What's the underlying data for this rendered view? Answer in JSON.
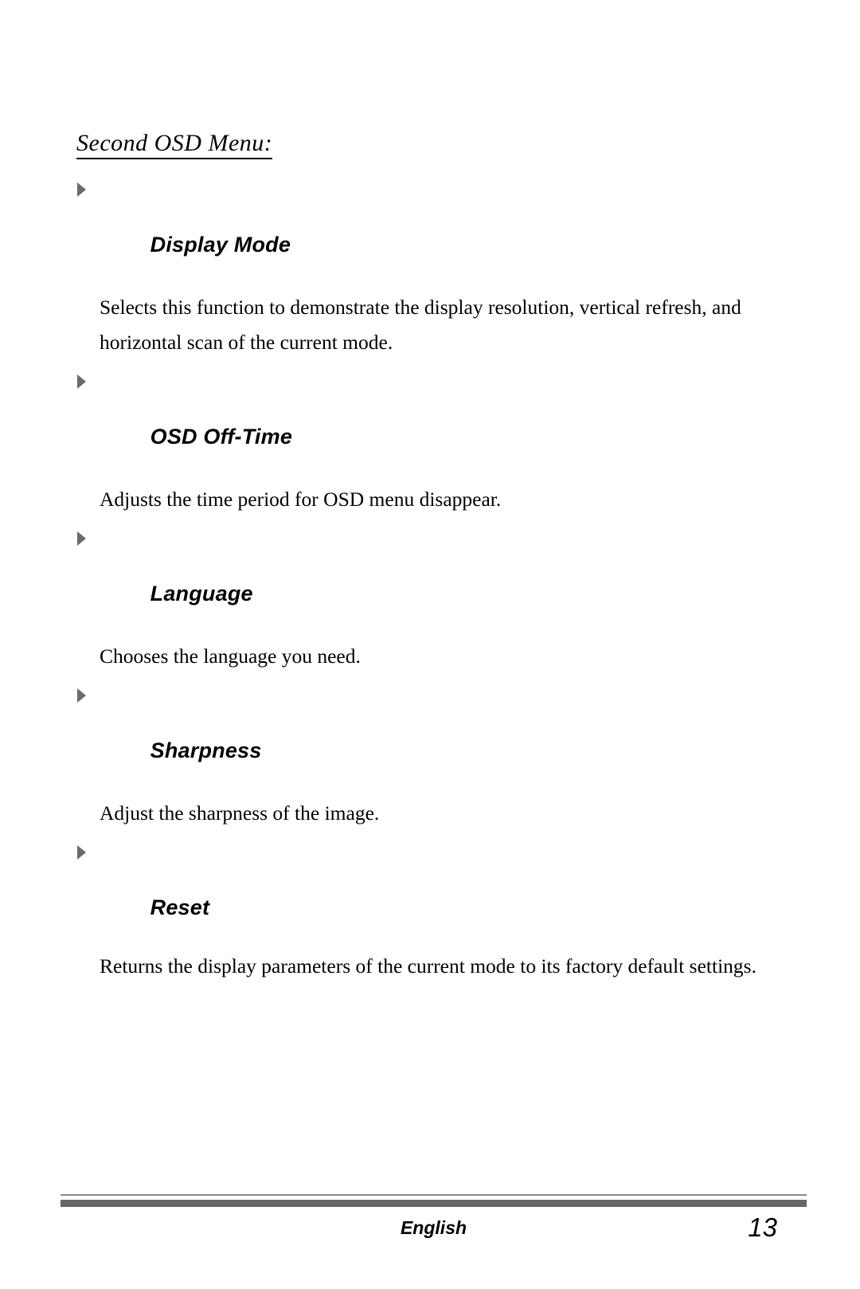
{
  "document": {
    "section_title": "Second OSD Menu:",
    "entries": [
      {
        "heading": "Display Mode",
        "body": "Selects this function to demonstrate the display resolution, vertical refresh, and horizontal scan of the current mode.",
        "bullet_icon": "triangle-right-icon"
      },
      {
        "heading": "OSD Off-Time",
        "body": "Adjusts the time period for OSD menu disappear.",
        "bullet_icon": "triangle-right-icon"
      },
      {
        "heading": "Language",
        "body": "Chooses the language you need.",
        "bullet_icon": "triangle-right-icon"
      },
      {
        "heading": "Sharpness",
        "body": "Adjust the sharpness of the image.",
        "bullet_icon": "triangle-right-icon"
      },
      {
        "heading": "Reset",
        "body": "Returns the display parameters of the current mode to its factory default settings.",
        "bullet_icon": "triangle-right-icon"
      }
    ]
  },
  "footer": {
    "language": "English",
    "page_number": "13"
  },
  "colors": {
    "bullet_gray": "#6b6b6b",
    "rule_thin_gray": "#8a8a8a",
    "rule_thick_gray": "#666666",
    "text_black": "#000000",
    "page_background": "#ffffff"
  }
}
